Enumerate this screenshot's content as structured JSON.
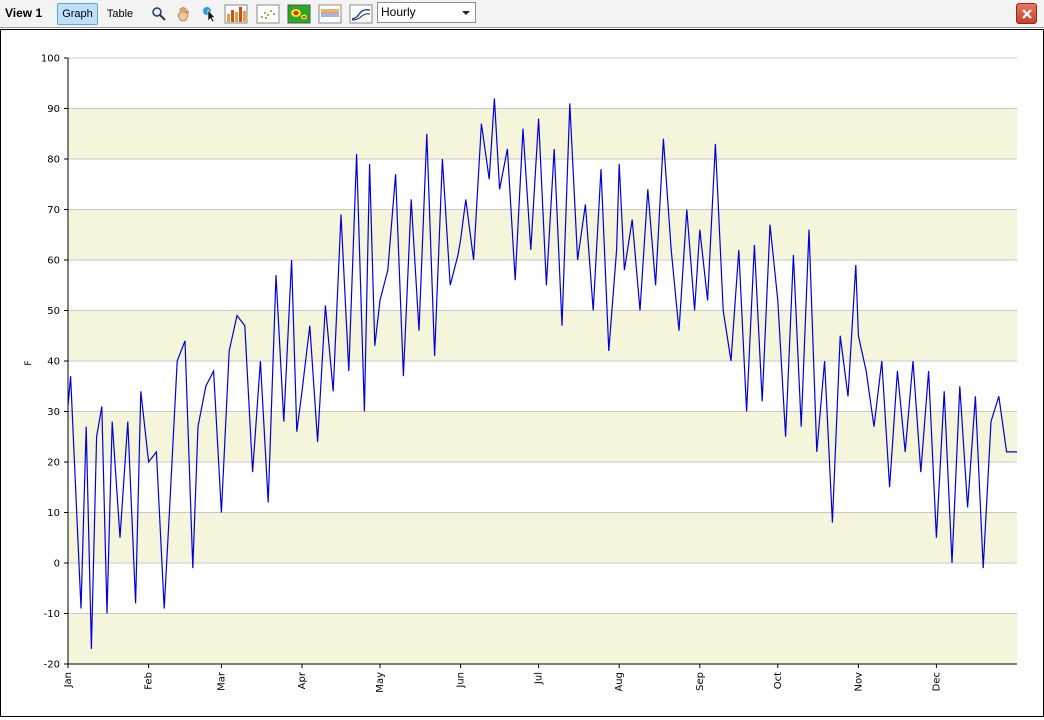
{
  "toolbar": {
    "view_title": "View 1",
    "graph_label": "Graph",
    "table_label": "Table",
    "interval_value": "Hourly",
    "icons": [
      "zoom-icon",
      "pan-icon",
      "pointer-icon",
      "bar-chart-icon",
      "scatter-icon",
      "heatmap-icon",
      "range-icon",
      "line-chart-icon"
    ]
  },
  "colors": {
    "series": "#0000dd",
    "band": "#f5f5dc",
    "grid": "#c8c8c8"
  },
  "chart_data": {
    "type": "line",
    "xlabel": "",
    "ylabel": "F",
    "ylim": [
      -20,
      100
    ],
    "yticks": [
      -20,
      -10,
      0,
      10,
      20,
      30,
      40,
      50,
      60,
      70,
      80,
      90,
      100
    ],
    "xlim": [
      0,
      365
    ],
    "month_labels": [
      "Jan",
      "Feb",
      "Mar",
      "Apr",
      "May",
      "Jun",
      "Jul",
      "Aug",
      "Sep",
      "Oct",
      "Nov",
      "Dec"
    ],
    "month_starts_day": [
      0,
      31,
      59,
      90,
      120,
      151,
      181,
      212,
      243,
      273,
      304,
      334
    ],
    "grid": true,
    "series": [
      {
        "x": [
          0,
          1,
          3,
          5,
          7,
          9,
          11,
          13,
          15,
          17,
          20,
          23,
          26,
          28,
          31,
          34,
          37,
          39,
          42,
          45,
          48,
          50,
          53,
          56,
          59,
          62,
          65,
          68,
          71,
          74,
          77,
          80,
          83,
          86,
          88,
          90,
          93,
          96,
          99,
          102,
          105,
          108,
          111,
          114,
          116,
          118,
          120,
          123,
          126,
          129,
          132,
          135,
          138,
          141,
          144,
          147,
          150,
          151,
          153,
          156,
          159,
          162,
          164,
          166,
          169,
          172,
          175,
          178,
          181,
          184,
          187,
          190,
          193,
          196,
          199,
          202,
          205,
          208,
          211,
          212,
          214,
          217,
          220,
          223,
          226,
          229,
          232,
          235,
          238,
          241,
          243,
          246,
          249,
          252,
          255,
          258,
          261,
          264,
          267,
          270,
          273,
          276,
          279,
          282,
          285,
          288,
          291,
          294,
          297,
          300,
          303,
          304,
          307,
          310,
          313,
          316,
          319,
          322,
          325,
          328,
          331,
          334,
          337,
          340,
          343,
          346,
          349,
          352,
          355,
          358,
          361,
          363,
          365
        ],
        "y": [
          31,
          37,
          14,
          -9,
          27,
          -17,
          25,
          31,
          -10,
          28,
          5,
          28,
          -8,
          34,
          20,
          22,
          -9,
          10,
          40,
          44,
          -1,
          27,
          35,
          38,
          10,
          42,
          49,
          47,
          18,
          40,
          12,
          57,
          28,
          60,
          26,
          34,
          47,
          24,
          51,
          34,
          69,
          38,
          81,
          30,
          79,
          43,
          52,
          58,
          77,
          37,
          72,
          46,
          85,
          41,
          80,
          55,
          61,
          64,
          72,
          60,
          87,
          76,
          92,
          74,
          82,
          56,
          86,
          62,
          88,
          55,
          82,
          47,
          91,
          60,
          71,
          50,
          78,
          42,
          62,
          79,
          58,
          68,
          50,
          74,
          55,
          84,
          62,
          46,
          70,
          50,
          66,
          52,
          83,
          50,
          40,
          62,
          30,
          63,
          32,
          67,
          52,
          25,
          61,
          27,
          66,
          22,
          40,
          8,
          45,
          33,
          59,
          45,
          38,
          27,
          40,
          15,
          38,
          22,
          40,
          18,
          38,
          5,
          34,
          0,
          35,
          11,
          33,
          -1,
          28,
          33,
          22,
          22,
          22
        ]
      }
    ]
  }
}
